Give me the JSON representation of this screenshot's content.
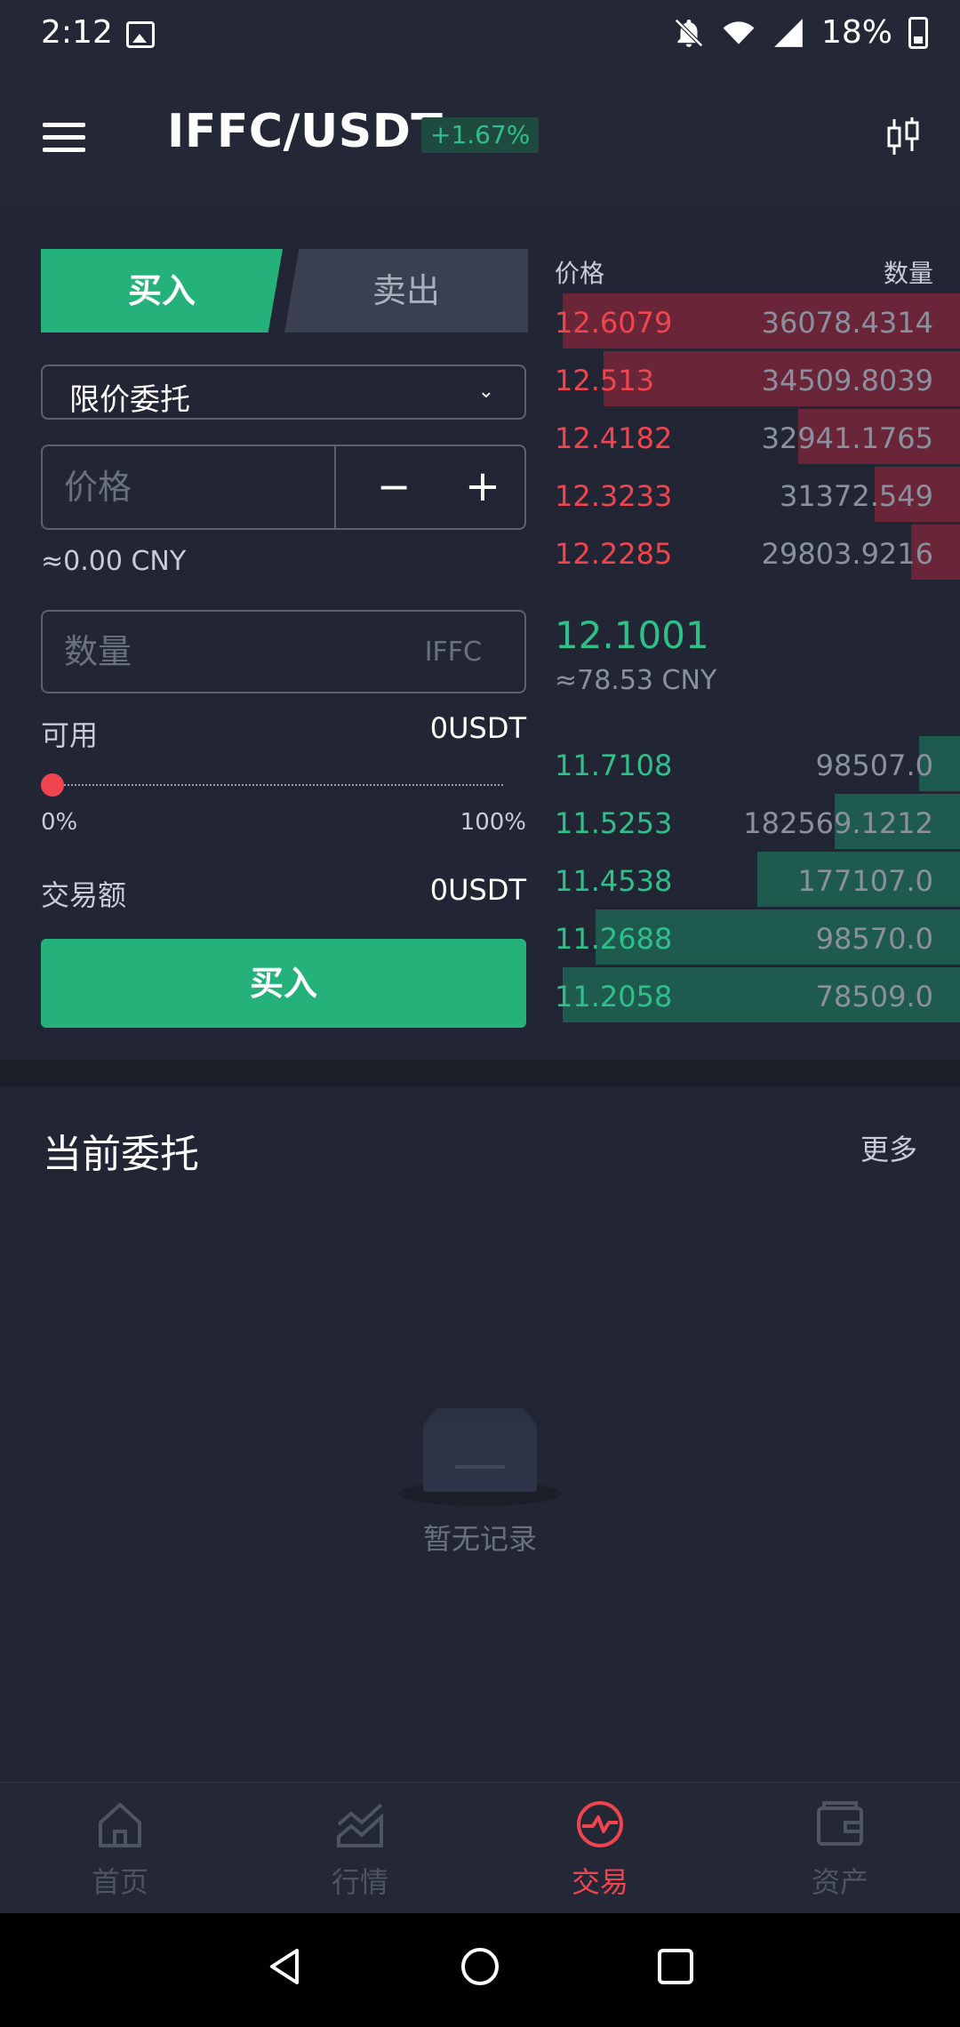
{
  "status": {
    "time": "2:12",
    "battery": "18%"
  },
  "header": {
    "pair": "IFFC/USDT",
    "change": "+1.67%"
  },
  "trade": {
    "tab_buy": "买入",
    "tab_sell": "卖出",
    "order_type": "限价委托",
    "price_placeholder": "价格",
    "minus": "−",
    "plus": "+",
    "cny_approx": "≈0.00 CNY",
    "qty_placeholder": "数量",
    "qty_unit": "IFFC",
    "available_label": "可用",
    "available_value": "0USDT",
    "slider_min": "0%",
    "slider_max": "100%",
    "slider_value": 0,
    "volume_label": "交易额",
    "volume_value": "0USDT",
    "buy_button": "买入"
  },
  "orderbook": {
    "header_price": "价格",
    "header_qty": "数量",
    "asks": [
      {
        "price": "12.6079",
        "qty": "36078.4314",
        "depth": 0.98
      },
      {
        "price": "12.513",
        "qty": "34509.8039",
        "depth": 0.88
      },
      {
        "price": "12.4182",
        "qty": "32941.1765",
        "depth": 0.4
      },
      {
        "price": "12.3233",
        "qty": "31372.549",
        "depth": 0.21
      },
      {
        "price": "12.2285",
        "qty": "29803.9216",
        "depth": 0.12
      }
    ],
    "last_price": "12.1001",
    "last_cny": "≈78.53 CNY",
    "bids": [
      {
        "price": "11.7108",
        "qty": "98507.0",
        "depth": 0.1
      },
      {
        "price": "11.5253",
        "qty": "182569.1212",
        "depth": 0.31
      },
      {
        "price": "11.4538",
        "qty": "177107.0",
        "depth": 0.5
      },
      {
        "price": "11.2688",
        "qty": "98570.0",
        "depth": 0.9
      },
      {
        "price": "11.2058",
        "qty": "78509.0",
        "depth": 0.98
      }
    ],
    "ask_color": "#f0444f",
    "bid_color": "#2fc08a"
  },
  "orders": {
    "title": "当前委托",
    "more": "更多",
    "empty": "暂无记录"
  },
  "nav": [
    {
      "label": "首页",
      "icon": "home-icon"
    },
    {
      "label": "行情",
      "icon": "market-chart-icon"
    },
    {
      "label": "交易",
      "icon": "trade-exchange-icon",
      "active": true
    },
    {
      "label": "资产",
      "icon": "wallet-icon"
    }
  ]
}
